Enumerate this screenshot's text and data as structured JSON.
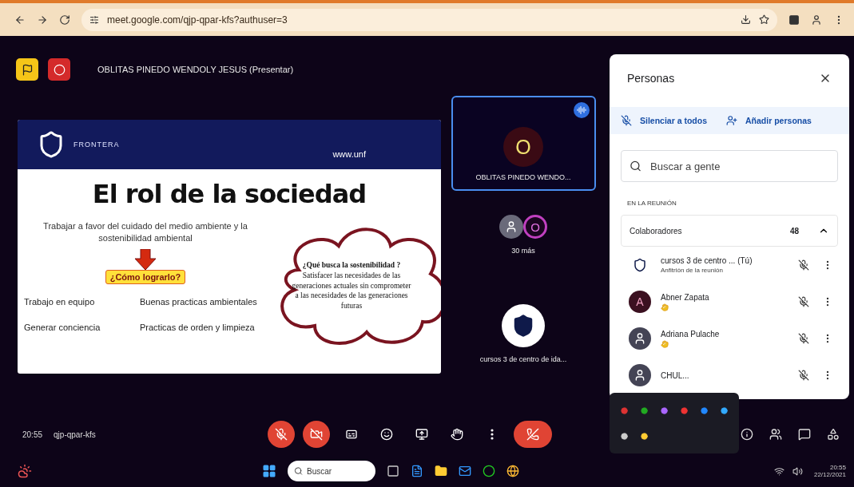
{
  "browser": {
    "url": "meet.google.com/qjp-qpar-kfs?authuser=3"
  },
  "presenter": {
    "label": "OBLITAS PINEDO WENDOLY JESUS (Presentar)"
  },
  "slide": {
    "header_text": "FRONTERA",
    "website": "www.unf",
    "title": "El rol de la sociedad",
    "intro": "Trabajar a favor del cuidado del medio ambiente y la sostenibilidad ambiental",
    "callout": "¿Cómo lograrlo?",
    "cloud": "**¿Qué busca la sostenibilidad ?** Satisfacer las necesidades de las generaciones actuales sin comprometer a las necesidades de las generaciones futuras",
    "actions": [
      "Trabajo en equipo",
      "Buenas practicas ambientales",
      "Generar conciencia",
      "Practicas de orden y limpieza"
    ]
  },
  "tiles": [
    {
      "kind": "speaker",
      "avatar": "O",
      "name": "OBLITAS PINEDO WENDO...",
      "selected": true
    },
    {
      "kind": "more",
      "avatar": "O",
      "name": "30 más",
      "selected": false
    },
    {
      "kind": "self",
      "name": "cursos 3 de centro de ida...",
      "selected": false
    }
  ],
  "people_panel": {
    "title": "Personas",
    "actions": [
      "Silenciar a todos",
      "Añadir personas"
    ],
    "search": {
      "placeholder": "Buscar a gente"
    },
    "section": "EN LA REUNIÓN",
    "group": {
      "label": "Colaboradores",
      "count": "48",
      "expanded": true
    },
    "participants": [
      {
        "kind": "logo",
        "name": "cursos 3 de centro ... (Tú)",
        "role": "Anfitrión de la reunión",
        "hand_raised": false
      },
      {
        "kind": "initial",
        "initial": "A",
        "name": "Abner Zapata",
        "hand_raised": true
      },
      {
        "kind": "photo",
        "name": "Adriana Pulache",
        "hand_raised": true
      },
      {
        "kind": "photo",
        "name": "CHUL...",
        "hand_raised": false
      }
    ]
  },
  "controls": {
    "time": "20:55",
    "code": "qjp-qpar-kfs",
    "buttons": [
      {
        "kind": "mic",
        "off": true
      },
      {
        "kind": "camera",
        "off": true
      },
      {
        "kind": "captions",
        "off": false
      },
      {
        "kind": "emoji",
        "off": false
      },
      {
        "kind": "present",
        "off": false
      },
      {
        "kind": "hand",
        "off": false
      },
      {
        "kind": "more",
        "off": false
      },
      {
        "kind": "leave"
      }
    ]
  },
  "taskbar": {
    "search": {
      "placeholder": "Buscar"
    },
    "time": "20:55",
    "date": "22/12/2021"
  }
}
